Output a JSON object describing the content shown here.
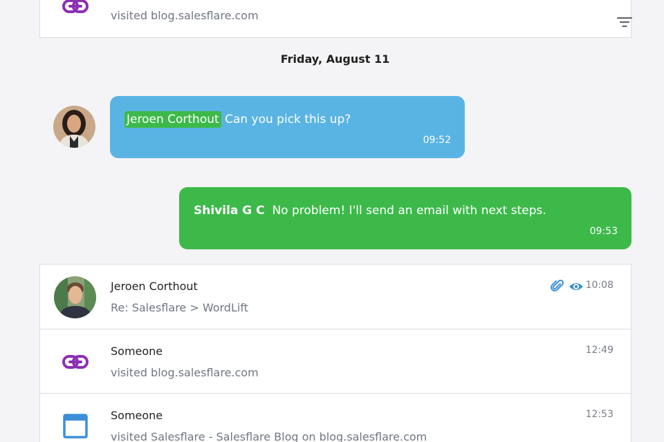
{
  "top_card": {
    "subtitle": "visited blog.salesflare.com",
    "link_icon": "link-icon",
    "filter_icon": "filter-icon"
  },
  "date_separator": "Friday, August 11",
  "messages": [
    {
      "mention": "Jeroen Corthout",
      "text": "Can you pick this up?",
      "time": "09:52",
      "color": "#5ab4e3"
    },
    {
      "sender": "Shivila G C",
      "text": "No problem! I'll send an email with next steps.",
      "time": "09:53",
      "color": "#3db94a"
    }
  ],
  "feed": [
    {
      "title": "Jeroen Corthout",
      "subtitle": "Re: Salesflare > WordLift",
      "time": "10:08",
      "icons": [
        "paperclip-icon",
        "eye-icon"
      ]
    },
    {
      "title": "Someone",
      "subtitle": "visited blog.salesflare.com",
      "time": "12:49",
      "icon": "link-icon"
    },
    {
      "title": "Someone",
      "subtitle": "visited Salesflare - Salesflare Blog on blog.salesflare.com",
      "time": "12:53",
      "icon": "browser-window-icon"
    }
  ],
  "colors": {
    "link_purple": "#8b2fb3",
    "accent_blue": "#3b8fd8",
    "bubble_blue": "#5ab4e3",
    "bubble_green": "#3db94a"
  }
}
